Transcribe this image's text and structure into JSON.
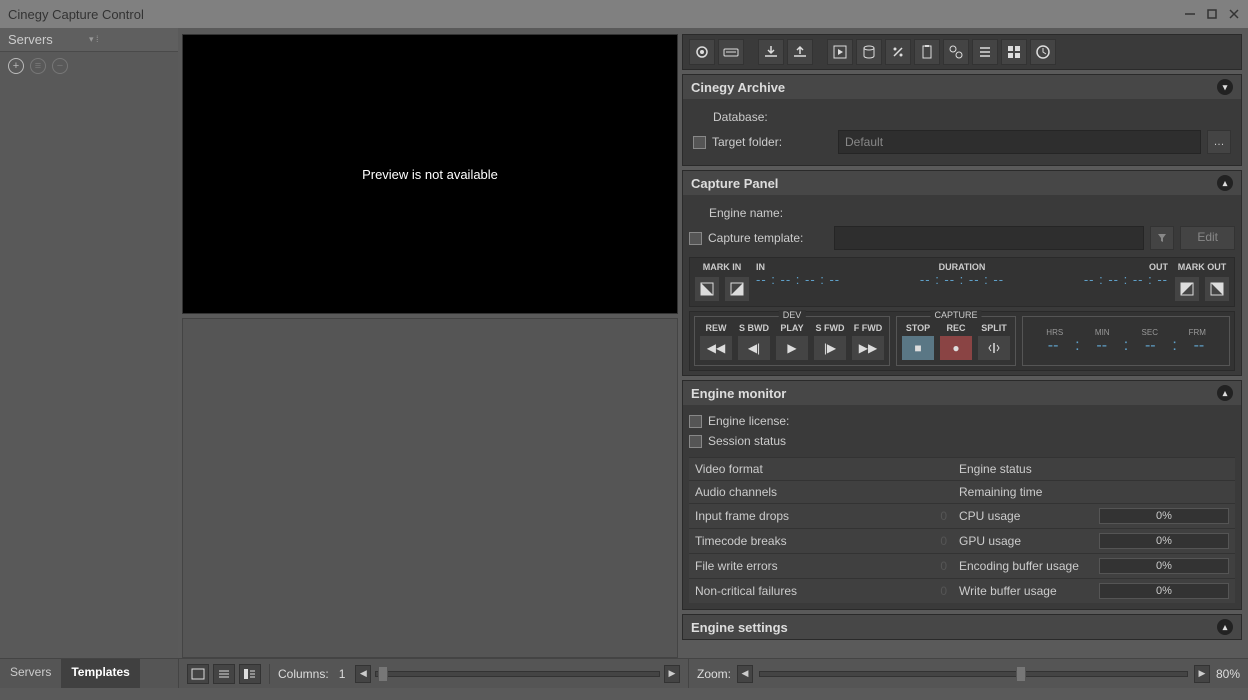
{
  "title": "Cinegy Capture Control",
  "sidebar": {
    "title": "Servers"
  },
  "preview": {
    "message": "Preview is not available"
  },
  "archive": {
    "title": "Cinegy Archive",
    "database_label": "Database:",
    "target_label": "Target folder:",
    "target_value": "Default"
  },
  "capture": {
    "title": "Capture Panel",
    "engine_label": "Engine name:",
    "template_label": "Capture template:",
    "edit": "Edit",
    "mark_in": "MARK IN",
    "in": "IN",
    "duration": "DURATION",
    "out": "OUT",
    "mark_out": "MARK OUT",
    "tc_blank": "-- : -- : -- : --",
    "dev": "DEV",
    "cap": "CAPTURE",
    "rew": "REW",
    "sbwd": "S BWD",
    "play": "PLAY",
    "sfwd": "S FWD",
    "ffwd": "F FWD",
    "stop": "STOP",
    "rec": "REC",
    "split": "SPLIT",
    "hrs": "HRS",
    "min": "MIN",
    "sec": "SEC",
    "frm": "FRM",
    "tdash": "--"
  },
  "monitor": {
    "title": "Engine monitor",
    "license": "Engine license:",
    "session": "Session status",
    "rows": [
      [
        "Video format",
        "",
        "Engine status",
        ""
      ],
      [
        "Audio channels",
        "",
        "Remaining time",
        ""
      ],
      [
        "Input frame drops",
        "0",
        "CPU usage",
        "0%"
      ],
      [
        "Timecode breaks",
        "0",
        "GPU usage",
        "0%"
      ],
      [
        "File write errors",
        "0",
        "Encoding buffer usage",
        "0%"
      ],
      [
        "Non-critical failures",
        "0",
        "Write buffer usage",
        "0%"
      ]
    ]
  },
  "settings": {
    "title": "Engine settings"
  },
  "footer": {
    "tab1": "Servers",
    "tab2": "Templates",
    "columns": "Columns:",
    "col_val": "1",
    "zoom": "Zoom:",
    "zoom_val": "80%"
  }
}
